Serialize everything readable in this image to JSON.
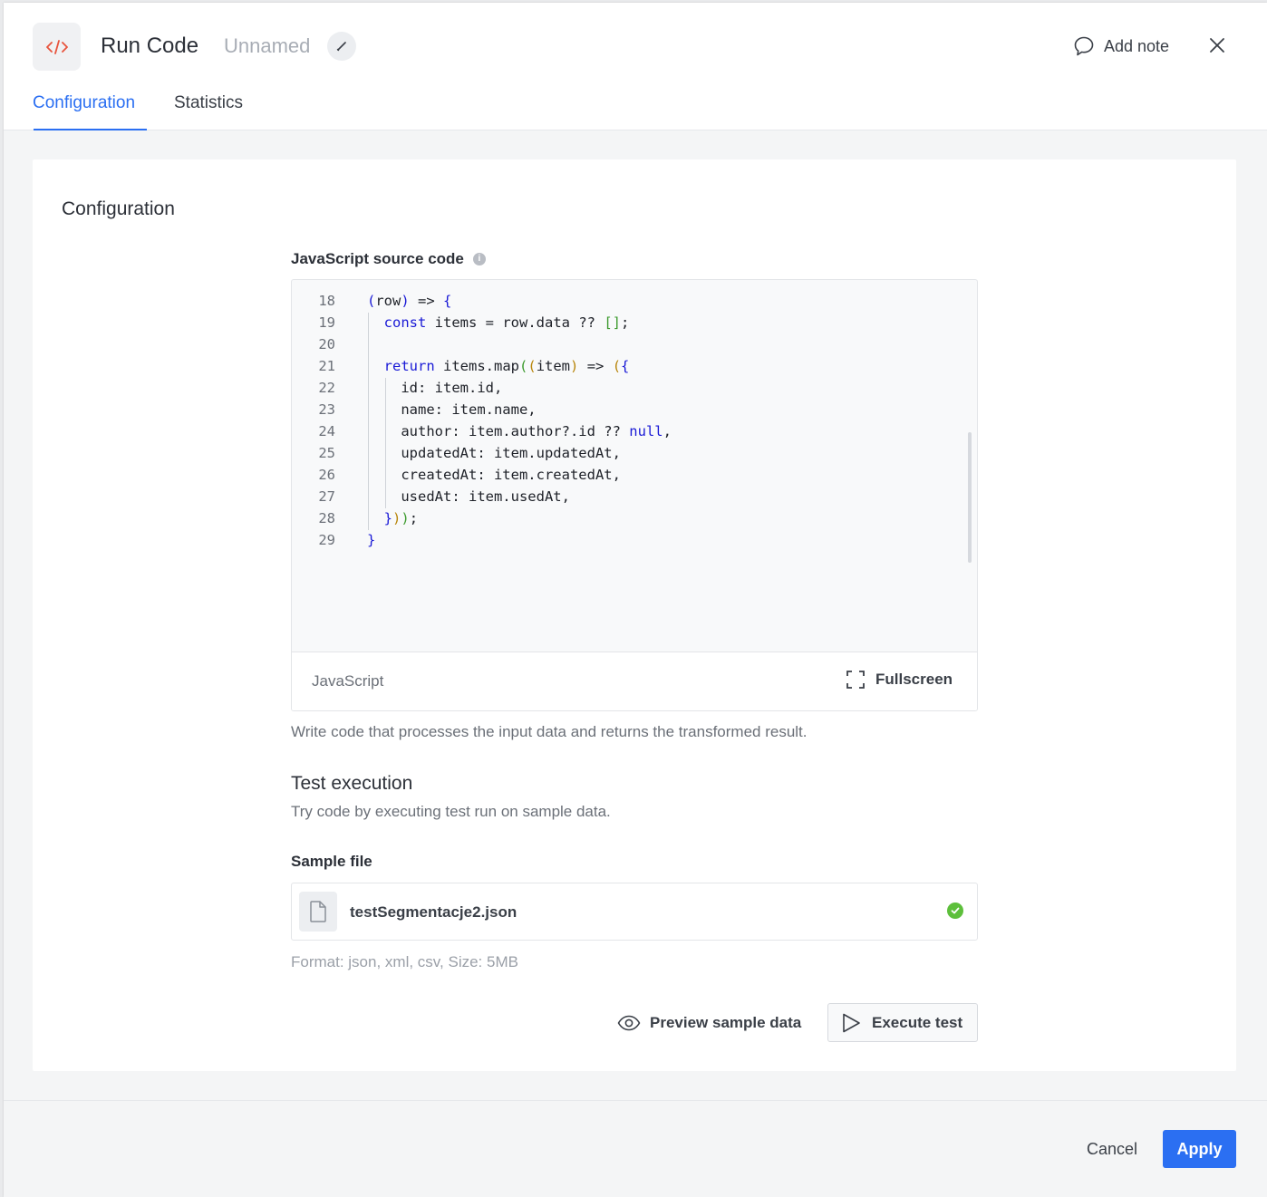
{
  "header": {
    "app_icon": "code-icon",
    "title": "Run Code",
    "subtitle": "Unnamed",
    "edit_icon": "pencil-icon",
    "add_note_label": "Add note",
    "add_note_icon": "speech-bubble-icon",
    "close_icon": "close-icon"
  },
  "tabs": [
    {
      "label": "Configuration",
      "active": true
    },
    {
      "label": "Statistics",
      "active": false
    }
  ],
  "card": {
    "title": "Configuration",
    "source_label": "JavaScript source code",
    "info_icon": "info-icon",
    "code_lines": [
      {
        "num": "18",
        "text": "(row) => {"
      },
      {
        "num": "19",
        "text": "  const items = row.data ?? [];"
      },
      {
        "num": "20",
        "text": ""
      },
      {
        "num": "21",
        "text": "  return items.map((item) => ({"
      },
      {
        "num": "22",
        "text": "    id: item.id,"
      },
      {
        "num": "23",
        "text": "    name: item.name,"
      },
      {
        "num": "24",
        "text": "    author: item.author?.id ?? null,"
      },
      {
        "num": "25",
        "text": "    updatedAt: item.updatedAt,"
      },
      {
        "num": "26",
        "text": "    createdAt: item.createdAt,"
      },
      {
        "num": "27",
        "text": "    usedAt: item.usedAt,"
      },
      {
        "num": "28",
        "text": "  }));"
      },
      {
        "num": "29",
        "text": "}"
      }
    ],
    "language": "JavaScript",
    "fullscreen_label": "Fullscreen",
    "fullscreen_icon": "expand-icon",
    "help_text": "Write code that processes the input data and returns the transformed result.",
    "test_title": "Test execution",
    "test_desc": "Try code by executing test run on sample data.",
    "sample_label": "Sample file",
    "file_icon": "document-icon",
    "file_name": "testSegmentacje2.json",
    "file_status_icon": "check-circle-icon",
    "file_status_color": "#5dbf3b",
    "format_text": "Format: json, xml, csv, Size: 5MB",
    "preview_label": "Preview sample data",
    "preview_icon": "eye-icon",
    "execute_label": "Execute test",
    "execute_icon": "play-icon"
  },
  "footer": {
    "cancel_label": "Cancel",
    "apply_label": "Apply"
  },
  "colors": {
    "accent": "#2b6ff2",
    "keyword": "#1a1ad6",
    "success": "#5dbf3b",
    "code_icon": "#e8533c"
  }
}
